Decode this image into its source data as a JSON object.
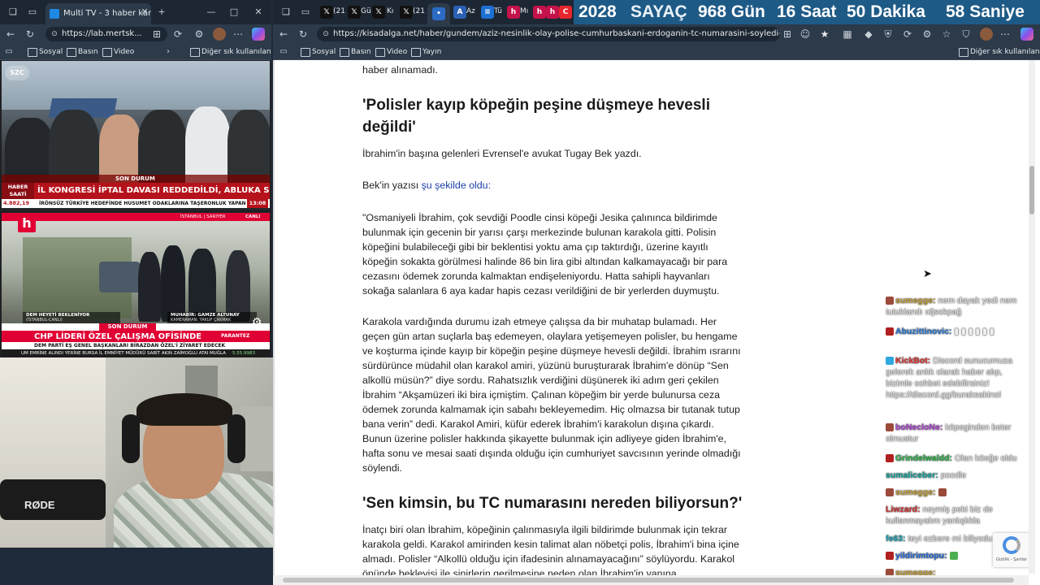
{
  "left_window": {
    "tab_title": "Multi TV - 3 haber kanalı",
    "url": "https://lab.mertsk...",
    "bookmarks": [
      "Sosyal",
      "Basın",
      "Video"
    ],
    "other_bookmarks": "Diğer sık kullanılanlar",
    "video1": {
      "channel": "SZC",
      "band_label_1": "HABER",
      "band_label_2": "SAATİ",
      "tag": "SON DURUM",
      "headline": "İL KONGRESİ İPTAL DAVASI REDDEDİLDİ, ABLUKA SONA ERDİ",
      "ticker_value": "4.882,19",
      "ticker_text": "İRÖNSÜZ TÜRKİYE HEDEFİNDE HUSUMET ODAKLARINA TAŞERONLUK YAPANLARA TAHAMMÜL GÖSTERİL",
      "time": "13:08"
    },
    "video2": {
      "channel": "h",
      "location": "İSTANBUL | SARIYER",
      "live": "CANLI",
      "caption_left": "DEM HEYETİ BEKLENİYOR",
      "caption_left_sub": "(İSTANBUL-CANLI)",
      "caption_right": "MUHABİR: GAMZE ALTUNAY",
      "caption_right_sub": "KAMERAMAN: YAKUP ÇAKMAK",
      "tag": "SON DURUM",
      "headline": "CHP LİDERİ ÖZEL ÇALIŞMA OFİSİNDE",
      "subline": "DEM PARTİ EŞ GENEL BAŞKANLARI BİRAZDAN ÖZEL'İ ZİYARET EDECEK",
      "side_label": "PARANTEZ",
      "ticker_text": "UM EMRİNE ALINDI YERİNE BURSA İL EMNİYET MÜDÜRÜ SABİT AKIN ZAİMOĞLU ATANDI",
      "ticker_place": "MUĞLA",
      "ticker_value": "5.55.9983"
    },
    "webcam_brand": "RØDE"
  },
  "right_window": {
    "tab_labels": [
      "(21",
      "Gü",
      "Kı",
      "(21",
      "Az",
      "Tü",
      "Mı",
      "Ay"
    ],
    "url": "https://kisadalga.net/haber/gundem/aziz-nesinlik-olay-polise-cumhurbaskani-erdoganin-tc-numarasini-soyledi-tutuklandi-132502",
    "bookmarks": [
      "Sosyal",
      "Basın",
      "Video",
      "Yayın"
    ],
    "other_bookmarks": "Diğer sık kullanılanlar",
    "countdown": {
      "year": "2028",
      "label": "SAYAÇ",
      "days": "968 Gün",
      "hours": "16 Saat",
      "minutes": "50 Dakika",
      "seconds": "58 Saniye"
    }
  },
  "article": {
    "intro_tail": "haber alınamadı.",
    "heading1": "'Polisler kayıp köpeğin peşine düşmeye hevesli değildi'",
    "para1": "İbrahim'in başına gelenleri Evrensel'e avukat Tugay Bek yazdı.",
    "para2_prefix": "Bek'in yazısı ",
    "para2_link": "şu şekilde oldu:",
    "quote1": "\"Osmaniyeli İbrahim, çok sevdiği Poodle cinsi köpeği Jesika çalınınca bildirimde bulunmak için gecenin bir yarısı çarşı merkezinde bulunan karakola gitti. Polisin köpeğini bulabileceği gibi bir beklentisi yoktu ama çıp taktırdığı, üzerine kayıtlı köpeğin sokakta görülmesi halinde 86 bin lira gibi altından kalkamayacağı bir para cezasını ödemek zorunda kalmaktan endişeleniyordu. Hatta sahipli hayvanları sokağa salanlara 6 aya kadar hapis cezası verildiğini de bir yerlerden duymuştu.",
    "quote2": "Karakola vardığında durumu izah etmeye çalışsa da bir muhatap bulamadı. Her geçen gün artan suçlarla baş edemeyen, olaylara yetişemeyen polisler, bu hengame ve koşturma içinde kayıp bir köpeğin peşine düşmeye hevesli değildi. İbrahim ısrarını sürdürünce müdahil olan karakol amiri, yüzünü buruşturarak İbrahim'e dönüp “Sen alkollü müsün?” diye sordu. Rahatsızlık verdiğini düşünerek iki adım geri çekilen İbrahim “Akşamüzeri iki bira içmiştim. Çalınan köpeğim bir yerde bulunursa ceza ödemek zorunda kalmamak için sabahı bekleyemedim. Hiç olmazsa bir tutanak tutup bana verin” dedi. Karakol Amiri, küfür ederek İbrahim'i karakolun dışına çıkardı. Bunun üzerine polisler hakkında şikayette bulunmak için adliyeye giden İbrahim'e, hafta sonu ve mesai saati dışında olduğu için cumhuriyet savcısının yerinde olmadığı söylendi.",
    "heading2": "'Sen kimsin, bu TC numarasını nereden biliyorsun?'",
    "para3": "İnatçı biri olan İbrahim, köpeğinin çalınmasıyla ilgili bildirimde bulunmak için tekrar karakola geldi. Karakol amirinden kesin talimat alan nöbetçi polis, İbrahim'i bina içine almadı. Polisler “Alkollü olduğu için ifadesinin alınamayacağını” söylüyordu. Karakol önünde bekleyişi ile sinirlerin gerilmesine neden olan İbrahim'in yanına"
  },
  "chat": [
    {
      "user": "sumegge:",
      "color": "#c7a13a",
      "text": "nem dayak yedi nem tutuklandı ıdjsokpağ"
    },
    {
      "user": "Abuzittinovic:",
      "color": "#2f7fd8",
      "text": "▮ ▮ ▮ ▮ ▮ ▮"
    },
    {
      "user": "KickBot:",
      "color": "#e03a3a",
      "text": "Discord sunucumuza gelerek anlık olarak haber alıp, bizimle sohbet edebilirsiniz! https://discord.gg/buraksakinol"
    },
    {
      "user": "boNecloNe:",
      "color": "#b04ad6",
      "text": "köpeginden beter olmustur"
    },
    {
      "user": "Grindelwaldd:",
      "color": "#2fb24a",
      "text": "Olan köeğe oldu"
    },
    {
      "user": "sumaliceber:",
      "color": "#1aa7a0",
      "text": "poodle"
    },
    {
      "user": "sumegge:",
      "color": "#c7a13a",
      "text": ""
    },
    {
      "user": "Liwzard:",
      "color": "#d23a3a",
      "text": "neymiş peki biz de kullanmayalım yanlışlıkla"
    },
    {
      "user": "fe63:",
      "color": "#23a8b8",
      "text": "teyi ezbere mi biliyodu acaba"
    },
    {
      "user": "yildirimtopu:",
      "color": "#2a6fd8",
      "text": ""
    },
    {
      "user": "sumegge:",
      "color": "#c7a13a",
      "text": ""
    }
  ],
  "recaptcha": {
    "label": "Gizlilik - Şartlar"
  }
}
